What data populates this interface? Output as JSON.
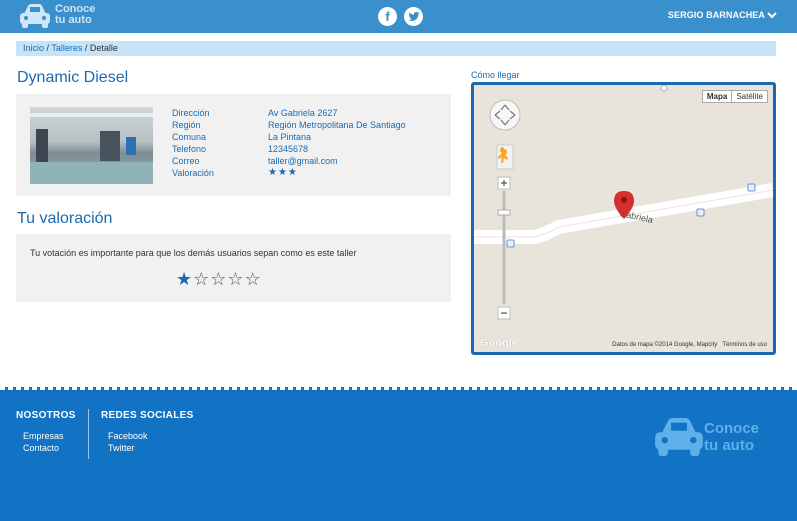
{
  "header": {
    "logo_line1": "Conoce",
    "logo_line2": "tu auto",
    "facebook_glyph": "f",
    "twitter_glyph": "t",
    "user_name": "SERGIO BARNACHEA"
  },
  "breadcrumb": {
    "home": "Inicio",
    "sep1": " / ",
    "section": "Talleres",
    "sep2": " / ",
    "current": "Detalle"
  },
  "shop": {
    "title": "Dynamic Diesel",
    "fields": [
      {
        "label": "Dirección",
        "value": "Av Gabriela 2627"
      },
      {
        "label": "Región",
        "value": "Región Metropolitana De Santiago"
      },
      {
        "label": "Comuna",
        "value": "La Pintana"
      },
      {
        "label": "Telefono",
        "value": "12345678"
      },
      {
        "label": "Correo",
        "value": "taller@gmail.com"
      },
      {
        "label": "Valoración",
        "value": "★★★"
      }
    ],
    "rating": 3
  },
  "rating_section": {
    "title": "Tu valoración",
    "prompt": "Tu votación es importante para que los demás usuarios sepan como es este taller",
    "user_rating": 1,
    "max_rating": 5
  },
  "map": {
    "link": "Cómo llegar",
    "type_map": "Mapa",
    "type_satellite": "Satélite",
    "street_label": "Gabriela",
    "attribution": "Datos de mapa ©2014 Google, Mapcity",
    "terms": "Términos de uso",
    "google": "Google"
  },
  "footer": {
    "col1_title": "NOSOTROS",
    "col1_items": [
      "Empresas",
      "Contacto"
    ],
    "col2_title": "REDES SOCIALES",
    "col2_items": [
      "Facebook",
      "Twitter"
    ],
    "logo_line1": "Conoce",
    "logo_line2": "tu auto"
  },
  "colors": {
    "header": "#3a8fcd",
    "accent": "#1b6ab1",
    "footer": "#1273c5",
    "breadcrumb_bg": "#c6e3f7",
    "card_bg": "#f1f1f2"
  }
}
